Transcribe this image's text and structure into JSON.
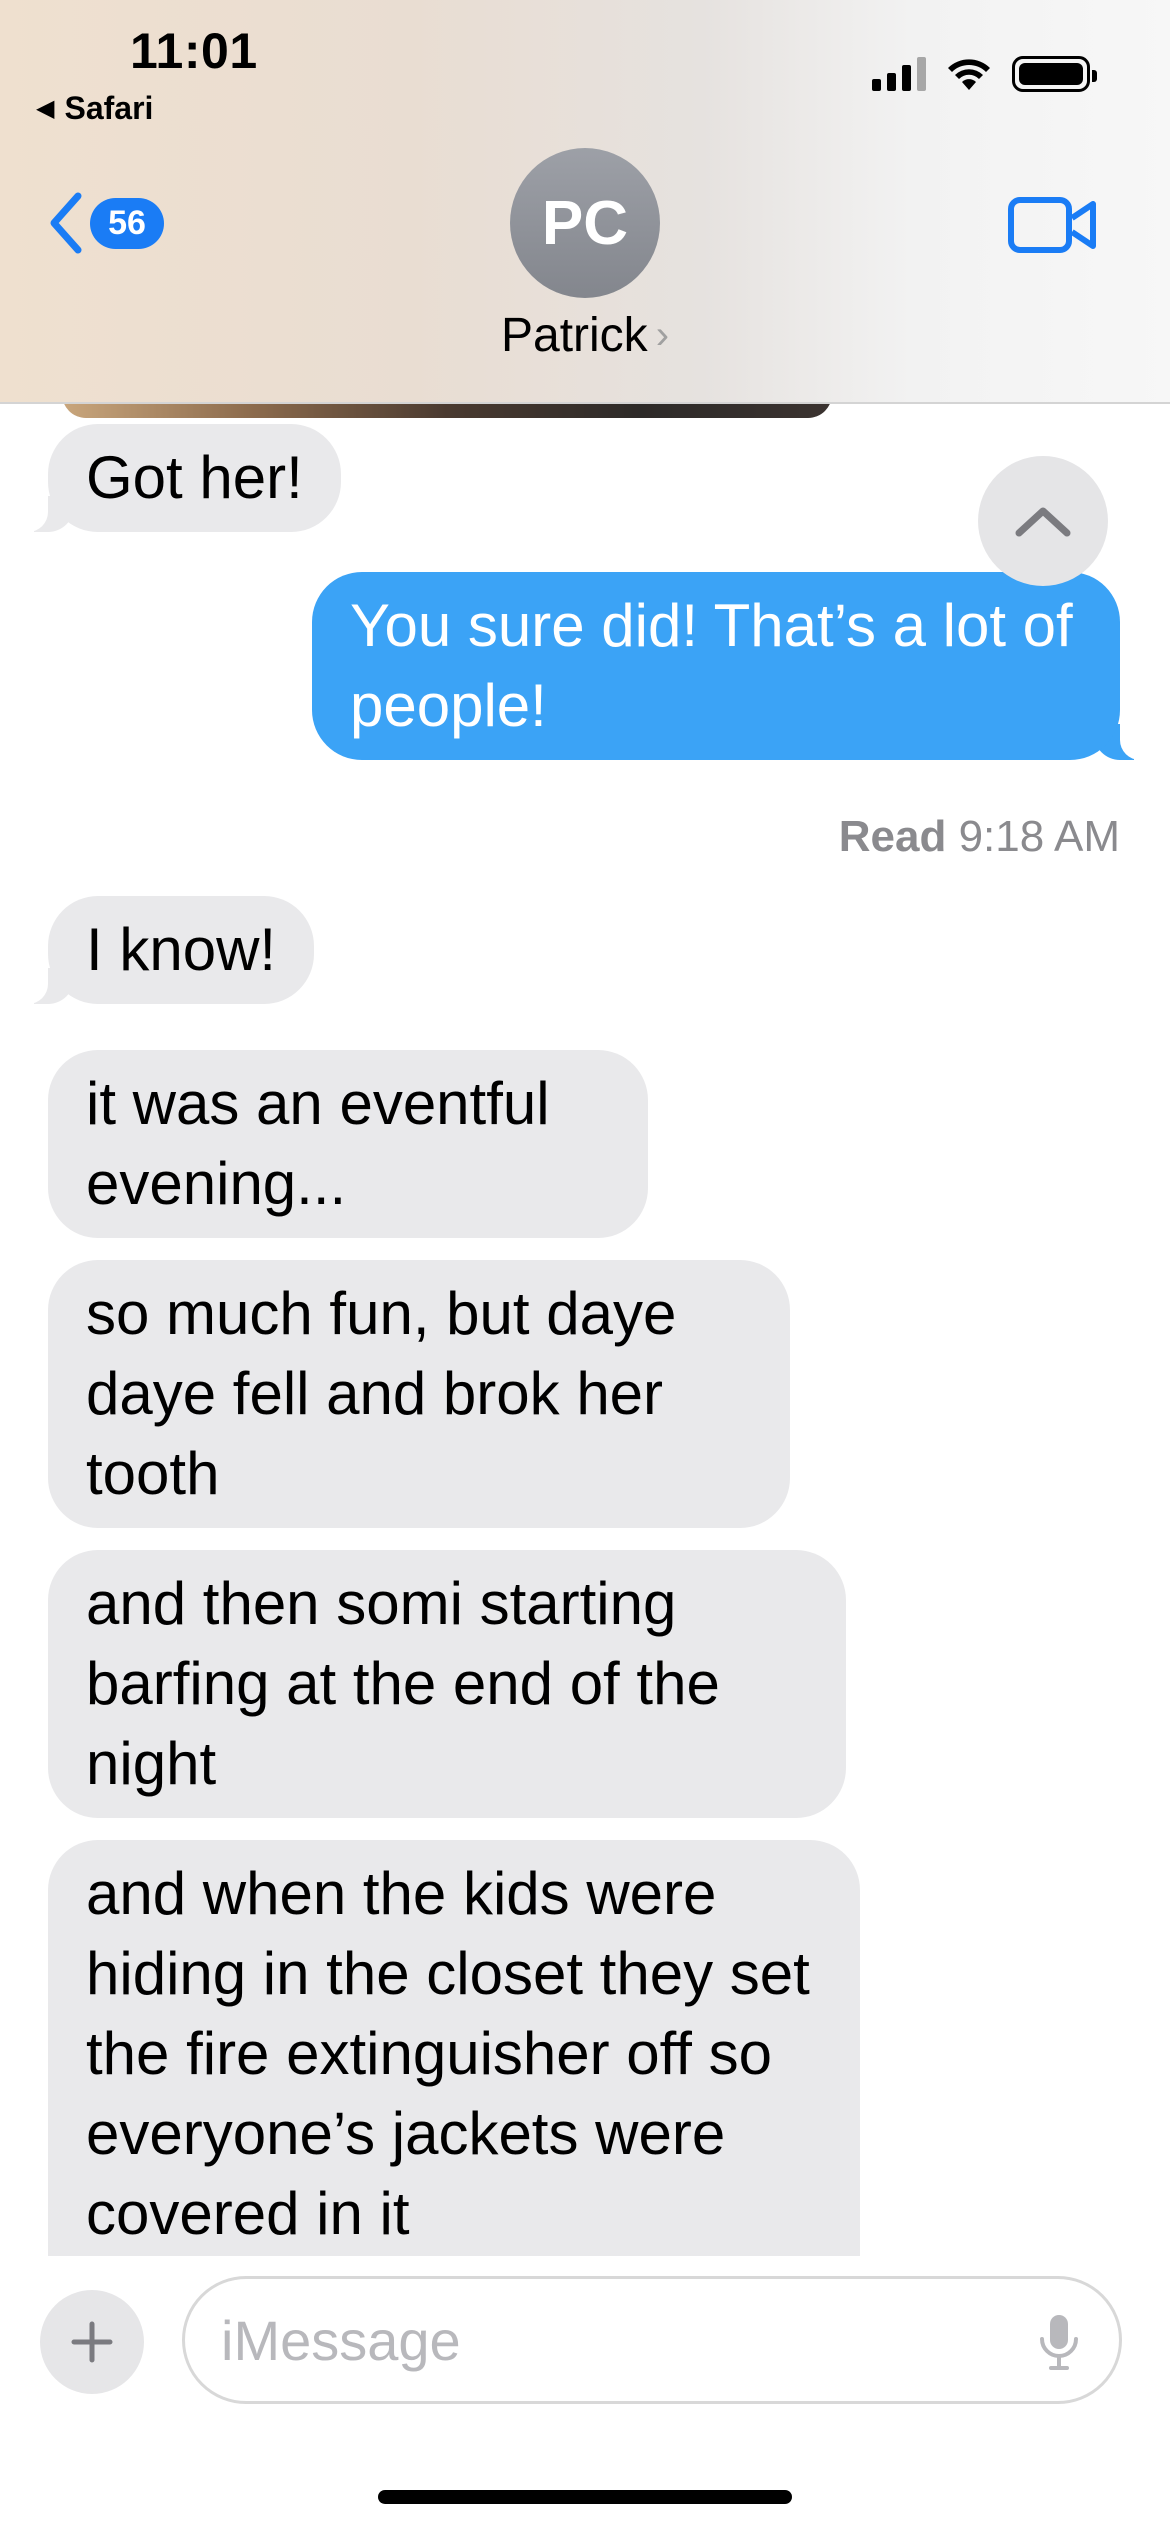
{
  "status_bar": {
    "time": "11:01",
    "back_app": "Safari"
  },
  "nav": {
    "unread_count": "56",
    "contact_initials": "PC",
    "contact_name": "Patrick",
    "accent_color": "#1a7cf5"
  },
  "messages": [
    {
      "from": "them",
      "text": "Got her!"
    },
    {
      "from": "me",
      "text": "You sure did! That’s a lot of people!"
    },
    {
      "from": "them",
      "text": "I know!"
    },
    {
      "from": "them",
      "text": "it was an eventful evening..."
    },
    {
      "from": "them",
      "text": "so much fun, but daye daye fell and brok her tooth"
    },
    {
      "from": "them",
      "text": "and then somi starting barfing at the end of the night"
    },
    {
      "from": "them",
      "text": "and when the kids were hiding in the closet they set the fire extinguisher off so everyone’s jackets were covered in it"
    }
  ],
  "read_receipt": {
    "label": "Read",
    "time": "9:18 AM"
  },
  "composer": {
    "placeholder": "iMessage"
  },
  "colors": {
    "sent_bubble": "#3ba3f6",
    "received_bubble": "#e9e9eb"
  },
  "icons": [
    "chevron-left-icon",
    "video-camera-icon",
    "chevron-up-icon",
    "plus-icon",
    "microphone-icon",
    "signal-icon",
    "wifi-icon",
    "battery-icon"
  ]
}
